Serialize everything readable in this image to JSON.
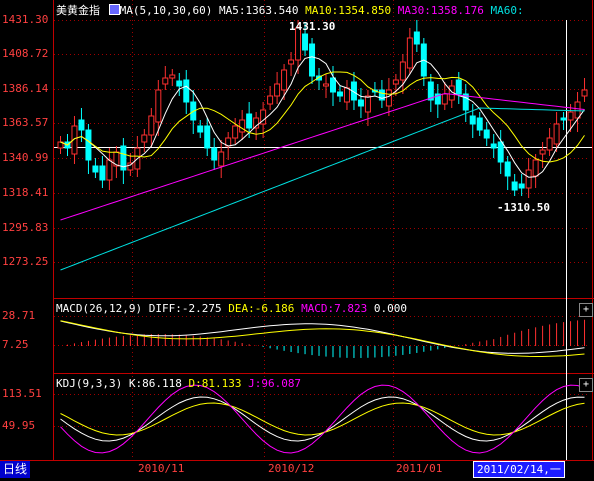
{
  "main": {
    "title": "美黄金指",
    "ma_indicator": "MA(5,10,30,60)",
    "ma5": "MA5:1363.540",
    "ma10": "MA10:1354.850",
    "ma30": "MA30:1358.176",
    "ma60": "MA60:",
    "y_ticks": [
      "1431.30",
      "1408.72",
      "1386.14",
      "1363.57",
      "1340.99",
      "1318.41",
      "1295.83",
      "1273.25"
    ],
    "high_label": "1431.30",
    "low_label": "-1310.50"
  },
  "macd": {
    "label": "MACD(26,12,9)",
    "diff": "DIFF:-2.275",
    "dea": "DEA:-6.186",
    "macd": "MACD:7.823",
    "extra": "0.000",
    "y_ticks": [
      "28.71",
      "7.25"
    ]
  },
  "kdj": {
    "label": "KDJ(9,3,3)",
    "k": "K:86.118",
    "d": "D:81.133",
    "j": "J:96.087",
    "y_ticks": [
      "113.51",
      "49.95"
    ]
  },
  "footer": {
    "period_tab": "日线",
    "dates": [
      "2010/11",
      "2010/12",
      "2011/01"
    ],
    "selected_date": "2011/02/14,一"
  },
  "colors": {
    "up": "#ff3030",
    "down": "#00ffff",
    "ma5": "#ffffff",
    "ma10": "#ffff00",
    "ma30": "#ff00ff",
    "ma60": "#00e0e0",
    "grid": "#a00000"
  },
  "plus_button": "+"
}
